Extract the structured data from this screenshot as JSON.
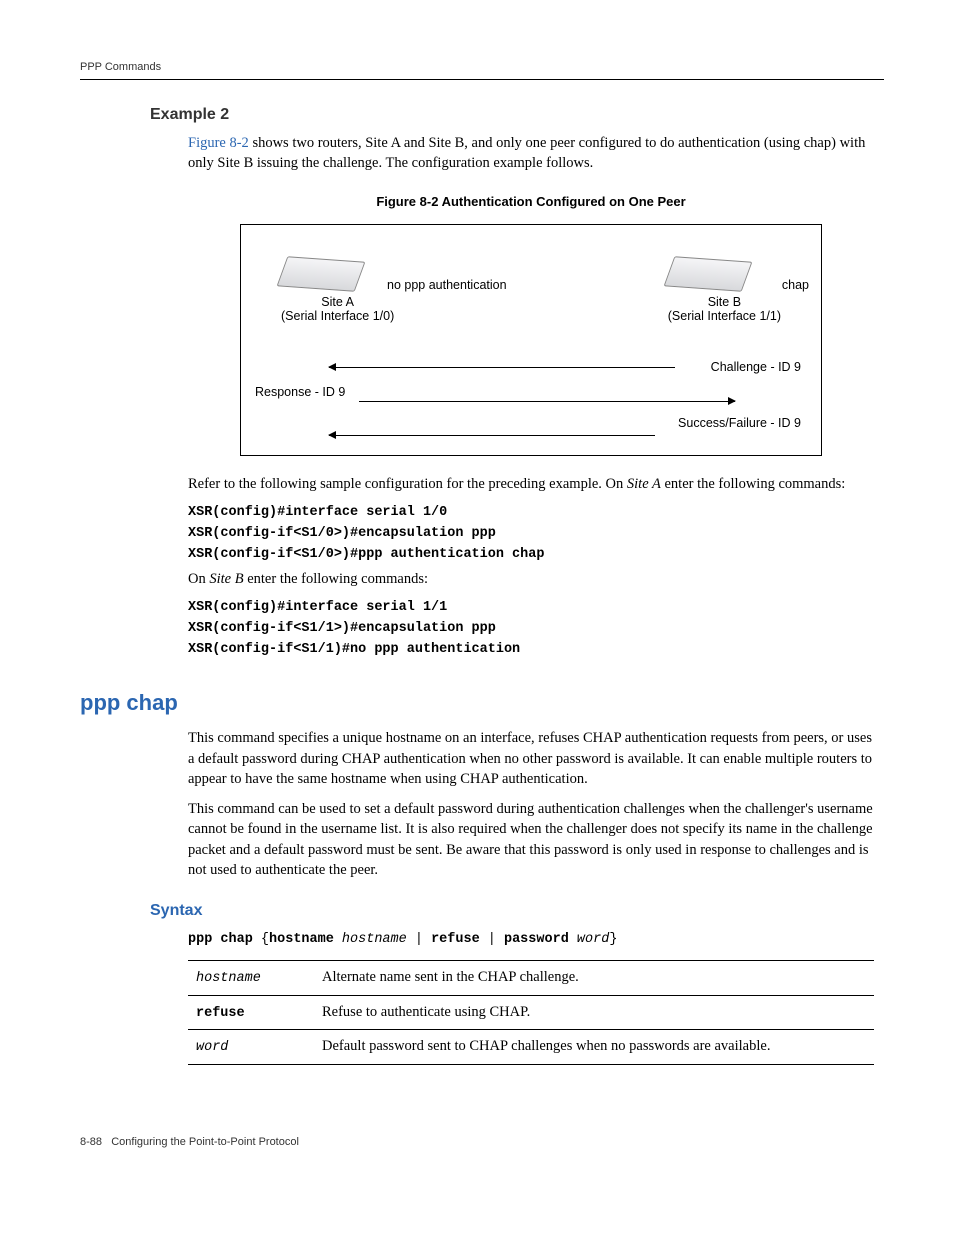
{
  "header": {
    "section": "PPP Commands"
  },
  "example2": {
    "heading": "Example 2",
    "intro_pre_link": "",
    "link_text": "Figure 8-2",
    "intro_post_link": " shows two routers, Site A and Site B, and only one peer configured to do authentication (using chap) with only Site B issuing the challenge. The configuration example follows."
  },
  "figure": {
    "caption": "Figure 8-2    Authentication Configured on One Peer",
    "no_auth": "no ppp authentication",
    "chap": "chap",
    "site_a": "Site A",
    "site_a_if": "(Serial Interface 1/0)",
    "site_b": "Site B",
    "site_b_if": "(Serial Interface 1/1)",
    "challenge": "Challenge - ID 9",
    "response": "Response - ID 9",
    "result": "Success/Failure - ID 9"
  },
  "sample_intro_pre": "Refer to the following sample configuration for the preceding example. On ",
  "sample_intro_site": "Site A",
  "sample_intro_post": " enter the following commands:",
  "code_a": [
    "XSR(config)#interface serial 1/0",
    "XSR(config-if<S1/0>)#encapsulation ppp",
    "XSR(config-if<S1/0>)#ppp authentication chap"
  ],
  "siteb_intro_pre": "On ",
  "siteb_intro_site": "Site B",
  "siteb_intro_post": " enter the following commands:",
  "code_b": [
    "XSR(config)#interface serial 1/1",
    "XSR(config-if<S1/1>)#encapsulation ppp",
    "XSR(config-if<S1/1)#no ppp authentication"
  ],
  "cmd": {
    "title": "ppp chap",
    "p1": "This command specifies a unique hostname on an interface, refuses CHAP authentication requests from peers, or uses a default password during CHAP authentication when no other password is available. It can enable multiple routers to appear to have the same hostname when using CHAP authentication.",
    "p2": "This command can be used to set a default password during authentication challenges when the challenger's username cannot be found in the username list. It is also required when the challenger does not specify its name in the challenge packet and a default password must be sent. Be aware that this password is only used in response to challenges and is not used to authenticate the peer."
  },
  "syntax": {
    "heading": "Syntax",
    "usage_prefix": "ppp chap",
    "usage_brace_open": " {",
    "usage_k1": "hostname",
    "usage_a1": " hostname",
    "usage_sep": " | ",
    "usage_k2": "refuse",
    "usage_k3": "password",
    "usage_a3": " word",
    "usage_brace_close": "}",
    "rows": [
      {
        "arg": "hostname",
        "desc": "Alternate name sent in the CHAP challenge.",
        "style": "italic"
      },
      {
        "arg": "refuse",
        "desc": "Refuse to authenticate using CHAP.",
        "style": "bold"
      },
      {
        "arg": "word",
        "desc": "Default password sent to CHAP challenges when no passwords are available.",
        "style": "italic"
      }
    ]
  },
  "footer": {
    "page": "8-88",
    "title": "Configuring the Point-to-Point Protocol"
  }
}
